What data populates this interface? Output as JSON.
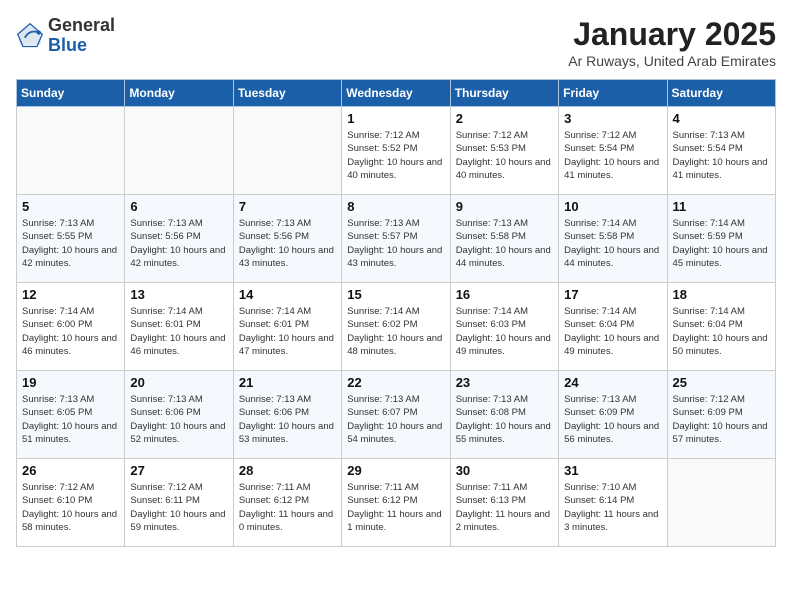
{
  "header": {
    "logo_general": "General",
    "logo_blue": "Blue",
    "month": "January 2025",
    "location": "Ar Ruways, United Arab Emirates"
  },
  "days_of_week": [
    "Sunday",
    "Monday",
    "Tuesday",
    "Wednesday",
    "Thursday",
    "Friday",
    "Saturday"
  ],
  "weeks": [
    [
      {
        "day": "",
        "sunrise": "",
        "sunset": "",
        "daylight": ""
      },
      {
        "day": "",
        "sunrise": "",
        "sunset": "",
        "daylight": ""
      },
      {
        "day": "",
        "sunrise": "",
        "sunset": "",
        "daylight": ""
      },
      {
        "day": "1",
        "sunrise": "Sunrise: 7:12 AM",
        "sunset": "Sunset: 5:52 PM",
        "daylight": "Daylight: 10 hours and 40 minutes."
      },
      {
        "day": "2",
        "sunrise": "Sunrise: 7:12 AM",
        "sunset": "Sunset: 5:53 PM",
        "daylight": "Daylight: 10 hours and 40 minutes."
      },
      {
        "day": "3",
        "sunrise": "Sunrise: 7:12 AM",
        "sunset": "Sunset: 5:54 PM",
        "daylight": "Daylight: 10 hours and 41 minutes."
      },
      {
        "day": "4",
        "sunrise": "Sunrise: 7:13 AM",
        "sunset": "Sunset: 5:54 PM",
        "daylight": "Daylight: 10 hours and 41 minutes."
      }
    ],
    [
      {
        "day": "5",
        "sunrise": "Sunrise: 7:13 AM",
        "sunset": "Sunset: 5:55 PM",
        "daylight": "Daylight: 10 hours and 42 minutes."
      },
      {
        "day": "6",
        "sunrise": "Sunrise: 7:13 AM",
        "sunset": "Sunset: 5:56 PM",
        "daylight": "Daylight: 10 hours and 42 minutes."
      },
      {
        "day": "7",
        "sunrise": "Sunrise: 7:13 AM",
        "sunset": "Sunset: 5:56 PM",
        "daylight": "Daylight: 10 hours and 43 minutes."
      },
      {
        "day": "8",
        "sunrise": "Sunrise: 7:13 AM",
        "sunset": "Sunset: 5:57 PM",
        "daylight": "Daylight: 10 hours and 43 minutes."
      },
      {
        "day": "9",
        "sunrise": "Sunrise: 7:13 AM",
        "sunset": "Sunset: 5:58 PM",
        "daylight": "Daylight: 10 hours and 44 minutes."
      },
      {
        "day": "10",
        "sunrise": "Sunrise: 7:14 AM",
        "sunset": "Sunset: 5:58 PM",
        "daylight": "Daylight: 10 hours and 44 minutes."
      },
      {
        "day": "11",
        "sunrise": "Sunrise: 7:14 AM",
        "sunset": "Sunset: 5:59 PM",
        "daylight": "Daylight: 10 hours and 45 minutes."
      }
    ],
    [
      {
        "day": "12",
        "sunrise": "Sunrise: 7:14 AM",
        "sunset": "Sunset: 6:00 PM",
        "daylight": "Daylight: 10 hours and 46 minutes."
      },
      {
        "day": "13",
        "sunrise": "Sunrise: 7:14 AM",
        "sunset": "Sunset: 6:01 PM",
        "daylight": "Daylight: 10 hours and 46 minutes."
      },
      {
        "day": "14",
        "sunrise": "Sunrise: 7:14 AM",
        "sunset": "Sunset: 6:01 PM",
        "daylight": "Daylight: 10 hours and 47 minutes."
      },
      {
        "day": "15",
        "sunrise": "Sunrise: 7:14 AM",
        "sunset": "Sunset: 6:02 PM",
        "daylight": "Daylight: 10 hours and 48 minutes."
      },
      {
        "day": "16",
        "sunrise": "Sunrise: 7:14 AM",
        "sunset": "Sunset: 6:03 PM",
        "daylight": "Daylight: 10 hours and 49 minutes."
      },
      {
        "day": "17",
        "sunrise": "Sunrise: 7:14 AM",
        "sunset": "Sunset: 6:04 PM",
        "daylight": "Daylight: 10 hours and 49 minutes."
      },
      {
        "day": "18",
        "sunrise": "Sunrise: 7:14 AM",
        "sunset": "Sunset: 6:04 PM",
        "daylight": "Daylight: 10 hours and 50 minutes."
      }
    ],
    [
      {
        "day": "19",
        "sunrise": "Sunrise: 7:13 AM",
        "sunset": "Sunset: 6:05 PM",
        "daylight": "Daylight: 10 hours and 51 minutes."
      },
      {
        "day": "20",
        "sunrise": "Sunrise: 7:13 AM",
        "sunset": "Sunset: 6:06 PM",
        "daylight": "Daylight: 10 hours and 52 minutes."
      },
      {
        "day": "21",
        "sunrise": "Sunrise: 7:13 AM",
        "sunset": "Sunset: 6:06 PM",
        "daylight": "Daylight: 10 hours and 53 minutes."
      },
      {
        "day": "22",
        "sunrise": "Sunrise: 7:13 AM",
        "sunset": "Sunset: 6:07 PM",
        "daylight": "Daylight: 10 hours and 54 minutes."
      },
      {
        "day": "23",
        "sunrise": "Sunrise: 7:13 AM",
        "sunset": "Sunset: 6:08 PM",
        "daylight": "Daylight: 10 hours and 55 minutes."
      },
      {
        "day": "24",
        "sunrise": "Sunrise: 7:13 AM",
        "sunset": "Sunset: 6:09 PM",
        "daylight": "Daylight: 10 hours and 56 minutes."
      },
      {
        "day": "25",
        "sunrise": "Sunrise: 7:12 AM",
        "sunset": "Sunset: 6:09 PM",
        "daylight": "Daylight: 10 hours and 57 minutes."
      }
    ],
    [
      {
        "day": "26",
        "sunrise": "Sunrise: 7:12 AM",
        "sunset": "Sunset: 6:10 PM",
        "daylight": "Daylight: 10 hours and 58 minutes."
      },
      {
        "day": "27",
        "sunrise": "Sunrise: 7:12 AM",
        "sunset": "Sunset: 6:11 PM",
        "daylight": "Daylight: 10 hours and 59 minutes."
      },
      {
        "day": "28",
        "sunrise": "Sunrise: 7:11 AM",
        "sunset": "Sunset: 6:12 PM",
        "daylight": "Daylight: 11 hours and 0 minutes."
      },
      {
        "day": "29",
        "sunrise": "Sunrise: 7:11 AM",
        "sunset": "Sunset: 6:12 PM",
        "daylight": "Daylight: 11 hours and 1 minute."
      },
      {
        "day": "30",
        "sunrise": "Sunrise: 7:11 AM",
        "sunset": "Sunset: 6:13 PM",
        "daylight": "Daylight: 11 hours and 2 minutes."
      },
      {
        "day": "31",
        "sunrise": "Sunrise: 7:10 AM",
        "sunset": "Sunset: 6:14 PM",
        "daylight": "Daylight: 11 hours and 3 minutes."
      },
      {
        "day": "",
        "sunrise": "",
        "sunset": "",
        "daylight": ""
      }
    ]
  ]
}
